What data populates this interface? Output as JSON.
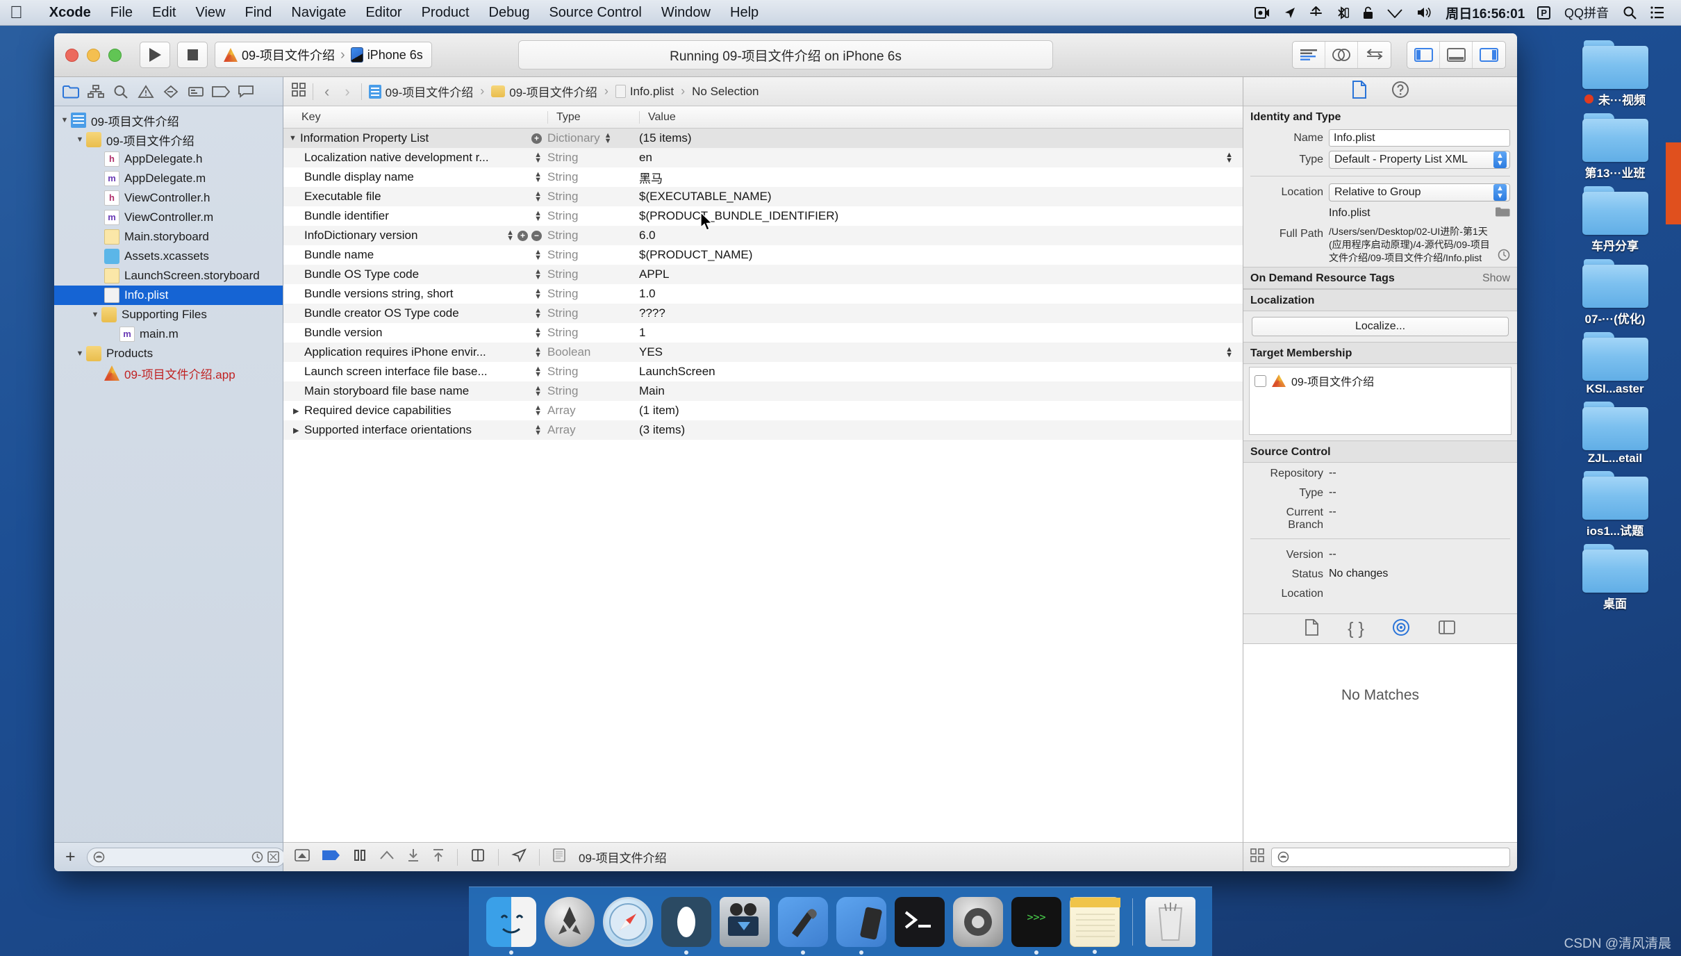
{
  "menubar": {
    "apple_icon": "apple-logo-icon",
    "items": [
      {
        "label": "Xcode",
        "bold": true
      },
      {
        "label": "File",
        "bold": false
      },
      {
        "label": "Edit",
        "bold": false
      },
      {
        "label": "View",
        "bold": false
      },
      {
        "label": "Find",
        "bold": false
      },
      {
        "label": "Navigate",
        "bold": false
      },
      {
        "label": "Editor",
        "bold": false
      },
      {
        "label": "Product",
        "bold": false
      },
      {
        "label": "Debug",
        "bold": false
      },
      {
        "label": "Source Control",
        "bold": false
      },
      {
        "label": "Window",
        "bold": false
      },
      {
        "label": "Help",
        "bold": false
      }
    ],
    "status_icons": [
      "screen-record-icon",
      "location-arrow-icon",
      "airdrop-icon",
      "bluetooth-icon",
      "lock-icon",
      "wifi-icon",
      "volume-icon"
    ],
    "clock": "周日16:56:01",
    "parallels_badge": "P",
    "input_method": "QQ拼音",
    "search_icon": "search-icon",
    "notification_icon": "notification-center-icon"
  },
  "toolbar": {
    "run_button": "run-button",
    "stop_button": "stop-button",
    "scheme_target": "09-项目文件介绍",
    "scheme_separator": "›",
    "scheme_device": "iPhone 6s",
    "status_text": "Running 09-项目文件介绍 on iPhone 6s",
    "editor_segments": [
      "standard-editor-icon",
      "assistant-editor-icon",
      "version-editor-icon"
    ],
    "view_segments": [
      "toggle-navigator-icon",
      "toggle-debug-area-icon",
      "toggle-utilities-icon"
    ]
  },
  "navigator": {
    "tabs": [
      "project-navigator-icon",
      "symbol-navigator-icon",
      "find-navigator-icon",
      "issue-navigator-icon",
      "test-navigator-icon",
      "debug-navigator-icon",
      "breakpoint-navigator-icon",
      "report-navigator-icon"
    ],
    "tree": [
      {
        "label": "09-项目文件介绍",
        "depth": 0,
        "icon": "proj",
        "twisty": "▼",
        "selected": false
      },
      {
        "label": "09-项目文件介绍",
        "depth": 1,
        "icon": "folder",
        "twisty": "▼",
        "selected": false
      },
      {
        "label": "AppDelegate.h",
        "depth": 2,
        "icon": "hfile",
        "twisty": "",
        "selected": false
      },
      {
        "label": "AppDelegate.m",
        "depth": 2,
        "icon": "mfile",
        "twisty": "",
        "selected": false
      },
      {
        "label": "ViewController.h",
        "depth": 2,
        "icon": "hfile",
        "twisty": "",
        "selected": false
      },
      {
        "label": "ViewController.m",
        "depth": 2,
        "icon": "mfile",
        "twisty": "",
        "selected": false
      },
      {
        "label": "Main.storyboard",
        "depth": 2,
        "icon": "sb",
        "twisty": "",
        "selected": false
      },
      {
        "label": "Assets.xcassets",
        "depth": 2,
        "icon": "assets",
        "twisty": "",
        "selected": false
      },
      {
        "label": "LaunchScreen.storyboard",
        "depth": 2,
        "icon": "sb",
        "twisty": "",
        "selected": false
      },
      {
        "label": "Info.plist",
        "depth": 2,
        "icon": "plistf",
        "twisty": "",
        "selected": true
      },
      {
        "label": "Supporting Files",
        "depth": 1,
        "icon": "folder",
        "twisty": "▼",
        "selected": false
      },
      {
        "label": "main.m",
        "depth": 2,
        "icon": "mfile",
        "twisty": "",
        "selected": false
      },
      {
        "label": "Products",
        "depth": 1,
        "icon": "folder",
        "twisty": "▼",
        "selected": false
      },
      {
        "label": "09-项目文件介绍.app",
        "depth": 2,
        "icon": "appicon",
        "twisty": "",
        "selected": false,
        "red": true
      }
    ],
    "add_button": "+",
    "filter_placeholder": "",
    "filter_icons": [
      "recent-files-icon",
      "source-control-filter-icon"
    ]
  },
  "jumpbar": {
    "related_icon": "related-items-icon",
    "back_arrow": "‹",
    "forward_arrow": "›",
    "crumbs": [
      {
        "label": "09-项目文件介绍",
        "icon": "proj"
      },
      {
        "label": "09-项目文件介绍",
        "icon": "folder"
      },
      {
        "label": "Info.plist",
        "icon": "plistf"
      },
      {
        "label": "No Selection",
        "icon": ""
      }
    ],
    "crumb_sep": "›"
  },
  "plist": {
    "columns": [
      "Key",
      "Type",
      "Value"
    ],
    "rows": [
      {
        "key": "Information Property List",
        "type": "Dictionary",
        "value": "(15 items)",
        "depth": 0,
        "twisty": "▼",
        "header": true
      },
      {
        "key": "Localization native development r...",
        "type": "String",
        "value": "en",
        "depth": 1,
        "twisty": ""
      },
      {
        "key": "Bundle display name",
        "type": "String",
        "value": "黑马",
        "depth": 1,
        "twisty": ""
      },
      {
        "key": "Executable file",
        "type": "String",
        "value": "$(EXECUTABLE_NAME)",
        "depth": 1,
        "twisty": ""
      },
      {
        "key": "Bundle identifier",
        "type": "String",
        "value": "$(PRODUCT_BUNDLE_IDENTIFIER)",
        "depth": 1,
        "twisty": ""
      },
      {
        "key": "InfoDictionary version",
        "type": "String",
        "value": "6.0",
        "depth": 1,
        "twisty": "",
        "hovered": true
      },
      {
        "key": "Bundle name",
        "type": "String",
        "value": "$(PRODUCT_NAME)",
        "depth": 1,
        "twisty": ""
      },
      {
        "key": "Bundle OS Type code",
        "type": "String",
        "value": "APPL",
        "depth": 1,
        "twisty": ""
      },
      {
        "key": "Bundle versions string, short",
        "type": "String",
        "value": "1.0",
        "depth": 1,
        "twisty": ""
      },
      {
        "key": "Bundle creator OS Type code",
        "type": "String",
        "value": "????",
        "depth": 1,
        "twisty": ""
      },
      {
        "key": "Bundle version",
        "type": "String",
        "value": "1",
        "depth": 1,
        "twisty": ""
      },
      {
        "key": "Application requires iPhone envir...",
        "type": "Boolean",
        "value": "YES",
        "depth": 1,
        "twisty": ""
      },
      {
        "key": "Launch screen interface file base...",
        "type": "String",
        "value": "LaunchScreen",
        "depth": 1,
        "twisty": ""
      },
      {
        "key": "Main storyboard file base name",
        "type": "String",
        "value": "Main",
        "depth": 1,
        "twisty": ""
      },
      {
        "key": "Required device capabilities",
        "type": "Array",
        "value": "(1 item)",
        "depth": 1,
        "twisty": "▶"
      },
      {
        "key": "Supported interface orientations",
        "type": "Array",
        "value": "(3 items)",
        "depth": 1,
        "twisty": "▶"
      }
    ]
  },
  "editor_bottom": {
    "icons": [
      "add-assistant-icon",
      "breakpoint-icon",
      "pause-icon",
      "step-over-icon",
      "step-into-icon",
      "step-out-icon",
      "view-hierarchy-icon",
      "location-simulate-icon",
      "process-icon"
    ],
    "process_label": "09-项目文件介绍"
  },
  "inspector": {
    "tabs": [
      "file-inspector-icon",
      "quick-help-icon"
    ],
    "identity_title": "Identity and Type",
    "name_label": "Name",
    "name_value": "Info.plist",
    "type_label": "Type",
    "type_value": "Default - Property List XML",
    "location_label": "Location",
    "location_value": "Relative to Group",
    "location_file": "Info.plist",
    "choose_folder_icon": "folder-picker-icon",
    "full_path_label": "Full Path",
    "full_path_value": "/Users/sen/Desktop/02-UI进阶-第1天(应用程序启动原理)/4-源代码/09-项目文件介绍/09-项目文件介绍/Info.plist",
    "reveal_icon": "reveal-in-finder-icon",
    "odr_title": "On Demand Resource Tags",
    "odr_show": "Show",
    "localization_title": "Localization",
    "localize_button": "Localize...",
    "target_membership_title": "Target Membership",
    "target_name": "09-项目文件介绍",
    "source_control_title": "Source Control",
    "sc_rows": [
      {
        "label": "Repository",
        "value": "--"
      },
      {
        "label": "Type",
        "value": "--"
      },
      {
        "label": "Current Branch",
        "value": "--"
      }
    ],
    "sc_rows2": [
      {
        "label": "Version",
        "value": "--"
      },
      {
        "label": "Status",
        "value": "No changes"
      },
      {
        "label": "Location",
        "value": ""
      }
    ]
  },
  "library": {
    "tabs": [
      "file-template-library-icon",
      "code-snippet-library-icon",
      "object-library-icon",
      "media-library-icon"
    ],
    "empty_text": "No Matches",
    "bottom_icons": [
      "library-grid-icon"
    ],
    "filter_placeholder": ""
  },
  "desktop": {
    "folders": [
      {
        "label": "未···视频",
        "dot": true
      },
      {
        "label": "第13···业班",
        "dot": false
      },
      {
        "label": "车丹分享",
        "dot": false
      },
      {
        "label": "07-···(优化)",
        "dot": false
      },
      {
        "label": "KSI...aster",
        "dot": false
      },
      {
        "label": "ZJL...etail",
        "dot": false
      },
      {
        "label": "ios1...试题",
        "dot": false
      },
      {
        "label": "桌面",
        "dot": false
      }
    ]
  },
  "dock": {
    "items": [
      {
        "name": "finder-icon",
        "running": true
      },
      {
        "name": "launchpad-icon",
        "running": false
      },
      {
        "name": "safari-icon",
        "running": false
      },
      {
        "name": "dash-icon",
        "running": true
      },
      {
        "name": "quicktime-icon",
        "running": false
      },
      {
        "name": "xcode-icon",
        "running": true
      },
      {
        "name": "xcode-beta-icon",
        "running": true
      },
      {
        "name": "terminal-icon",
        "running": false
      },
      {
        "name": "system-preferences-icon",
        "running": false
      },
      {
        "name": "iterm-icon",
        "running": true
      },
      {
        "name": "notes-icon",
        "running": true
      },
      {
        "name": "trash-icon",
        "running": false
      }
    ]
  },
  "watermark": "CSDN @清风清晨"
}
